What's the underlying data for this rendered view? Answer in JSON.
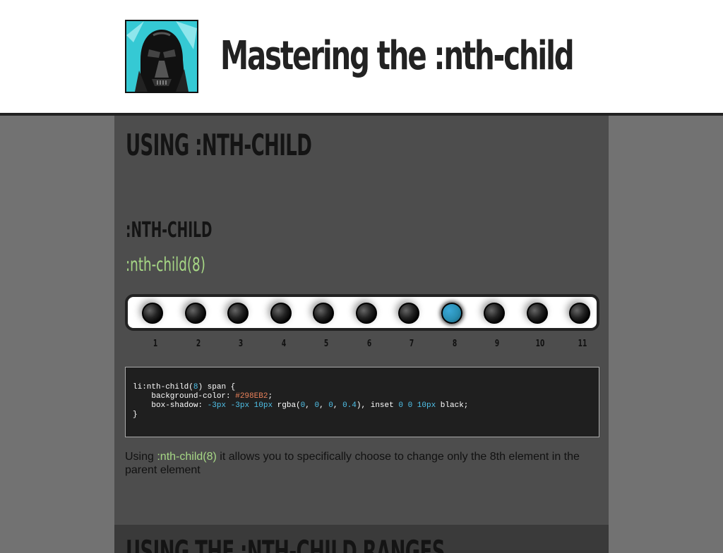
{
  "header": {
    "title": "Mastering the :nth-child",
    "avatar_icon": "darth-vader-icon",
    "avatar_bg": "#35c9d4"
  },
  "section": {
    "title": "USING :NTH-CHILD",
    "subtitle": ":NTH-CHILD",
    "selector": ":nth-child(8)",
    "active_index": 8,
    "active_color": "#298EB2",
    "numbers": [
      "1",
      "2",
      "3",
      "4",
      "5",
      "6",
      "7",
      "8",
      "9",
      "10",
      "11"
    ],
    "code": {
      "line1_a": "li:nth-child(",
      "line1_num": "8",
      "line1_b": ") span {",
      "line2_a": "    background-color: ",
      "line2_val": "#298EB2",
      "line2_b": ";",
      "line3_a": "    box-shadow: ",
      "line3_n1": "-3px",
      "line3_n2": "-3px",
      "line3_n3": "10px",
      "line3_b": " rgba(",
      "line3_r": "0",
      "line3_g": "0",
      "line3_bl": "0",
      "line3_al": "0.4",
      "line3_c": "), inset ",
      "line3_i1": "0",
      "line3_i2": "0",
      "line3_i3": "10px",
      "line3_d": " black;",
      "line4": "}"
    },
    "description_prefix": "Using ",
    "description_highlight": ":nth-child(8)",
    "description_suffix": " it allows you to specifically choose to change only the 8th element in the parent element"
  },
  "next_section": {
    "title": "USING THE :NTH-CHILD RANGES"
  }
}
